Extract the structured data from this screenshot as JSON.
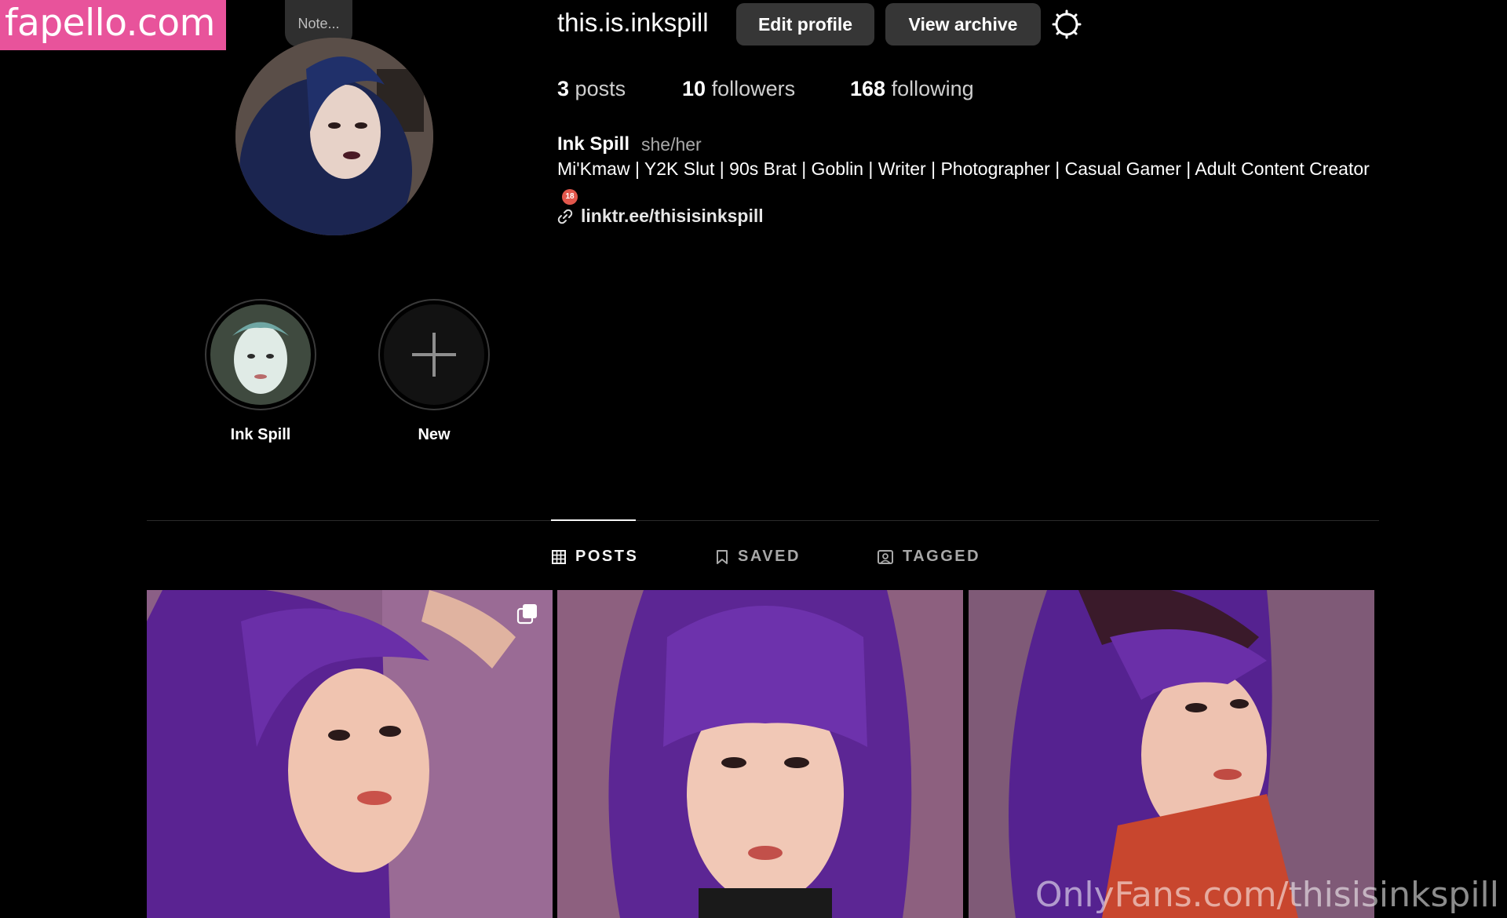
{
  "watermark": {
    "site": "fapello.com",
    "footer": "OnlyFans.com/thisisinkspill"
  },
  "note": {
    "label": "Note..."
  },
  "profile": {
    "username": "this.is.inkspill",
    "edit_label": "Edit profile",
    "archive_label": "View archive",
    "stats": [
      {
        "count": "3",
        "label": "posts"
      },
      {
        "count": "10",
        "label": "followers"
      },
      {
        "count": "168",
        "label": "following"
      }
    ],
    "display_name": "Ink Spill",
    "pronouns": "she/her",
    "bio": "Mi'Kmaw | Y2K Slut | 90s Brat | Goblin | Writer | Photographer | Casual Gamer | Adult Content Creator",
    "age_badge": "18",
    "link": "linktr.ee/thisisinkspill"
  },
  "highlights": [
    {
      "label": "Ink Spill"
    },
    {
      "label": "New"
    }
  ],
  "tabs": [
    {
      "label": "POSTS",
      "active": true
    },
    {
      "label": "SAVED",
      "active": false
    },
    {
      "label": "TAGGED",
      "active": false
    }
  ],
  "colors": {
    "background": "#000000",
    "button": "#363636",
    "badge": "#e8539b",
    "purple": "#6a2fa8"
  }
}
